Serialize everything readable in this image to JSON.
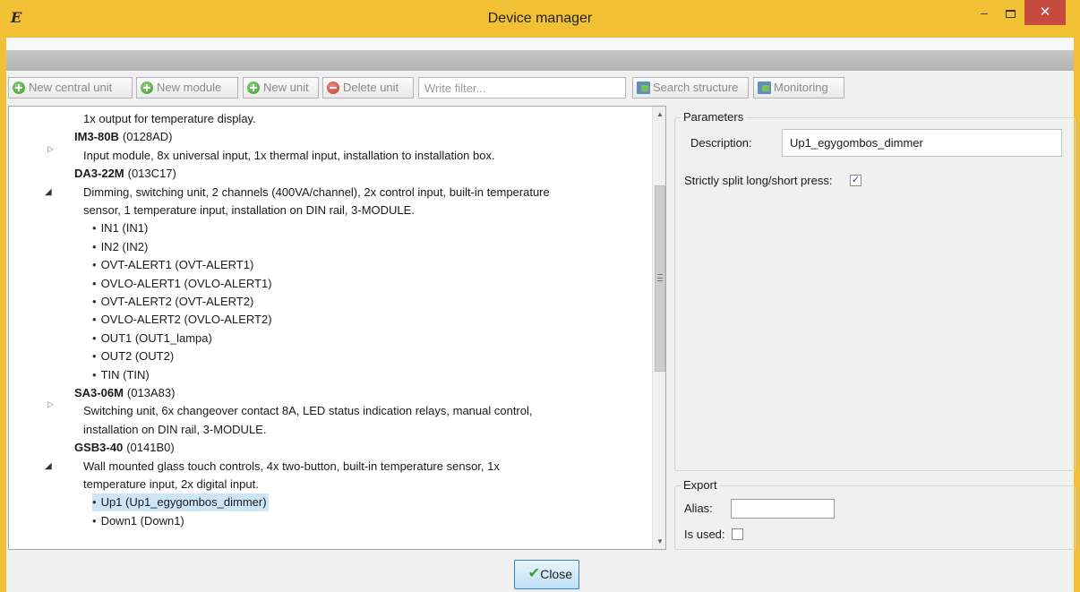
{
  "window": {
    "title": "Device manager",
    "app_icon_glyph": "E",
    "minimize_glyph": "‒",
    "close_glyph": "✕"
  },
  "toolbar": {
    "new_central_unit": "New central unit",
    "new_module": "New module",
    "new_unit": "New unit",
    "delete_unit": "Delete unit",
    "filter_placeholder": "Write filter...",
    "filter_value": "",
    "search_structure": "Search structure",
    "monitoring": "Monitoring"
  },
  "tree": {
    "items": [
      {
        "kind": "desc",
        "text": "1x output for temperature display."
      },
      {
        "kind": "device",
        "name": "IM3-80B",
        "code": "(0128AD)"
      },
      {
        "kind": "desc",
        "text": "Input module, 8x universal input, 1x thermal input, installation to installation box.",
        "expander": "collapsed"
      },
      {
        "kind": "device",
        "name": "DA3-22M",
        "code": "(013C17)"
      },
      {
        "kind": "desc",
        "text": "Dimming, switching unit, 2 channels (400VA/channel), 2x control input, built-in temperature",
        "expander": "expanded"
      },
      {
        "kind": "desc",
        "text": "sensor, 1 temperature input, installation on DIN rail, 3-MODULE."
      },
      {
        "kind": "channel",
        "text": "IN1 (IN1)"
      },
      {
        "kind": "channel",
        "text": "IN2 (IN2)"
      },
      {
        "kind": "channel",
        "text": "OVT-ALERT1 (OVT-ALERT1)"
      },
      {
        "kind": "channel",
        "text": "OVLO-ALERT1 (OVLO-ALERT1)"
      },
      {
        "kind": "channel",
        "text": "OVT-ALERT2 (OVT-ALERT2)"
      },
      {
        "kind": "channel",
        "text": "OVLO-ALERT2 (OVLO-ALERT2)"
      },
      {
        "kind": "channel",
        "text": "OUT1 (OUT1_lampa)"
      },
      {
        "kind": "channel",
        "text": "OUT2 (OUT2)"
      },
      {
        "kind": "channel",
        "text": "TIN (TIN)"
      },
      {
        "kind": "device",
        "name": "SA3-06M",
        "code": "(013A83)"
      },
      {
        "kind": "desc",
        "text": "Switching unit, 6x changeover contact 8A, LED status indication relays, manual control,",
        "expander": "collapsed"
      },
      {
        "kind": "desc",
        "text": "installation on DIN rail, 3-MODULE."
      },
      {
        "kind": "device",
        "name": "GSB3-40",
        "code": "(0141B0)"
      },
      {
        "kind": "desc",
        "text": "Wall mounted glass touch controls, 4x two-button, built-in temperature sensor, 1x",
        "expander": "expanded"
      },
      {
        "kind": "desc",
        "text": "temperature input, 2x digital input."
      },
      {
        "kind": "channel",
        "text": "Up1 (Up1_egygombos_dimmer)",
        "selected": true
      },
      {
        "kind": "channel",
        "text": "Down1 (Down1)"
      }
    ]
  },
  "parameters": {
    "group_label": "Parameters",
    "description_label": "Description:",
    "description_value": "Up1_egygombos_dimmer",
    "split_label": "Strictly split long/short press:",
    "split_checked": true
  },
  "export": {
    "group_label": "Export",
    "alias_label": "Alias:",
    "alias_value": "",
    "is_used_label": "Is used:",
    "is_used_checked": false
  },
  "footer": {
    "close_label": "Close"
  },
  "colors": {
    "title_bar": "#f2c035",
    "close_button": "#c74a3e",
    "selection": "#cde6f7",
    "icon_green": "#3a9a2c",
    "icon_red": "#c0392b"
  }
}
